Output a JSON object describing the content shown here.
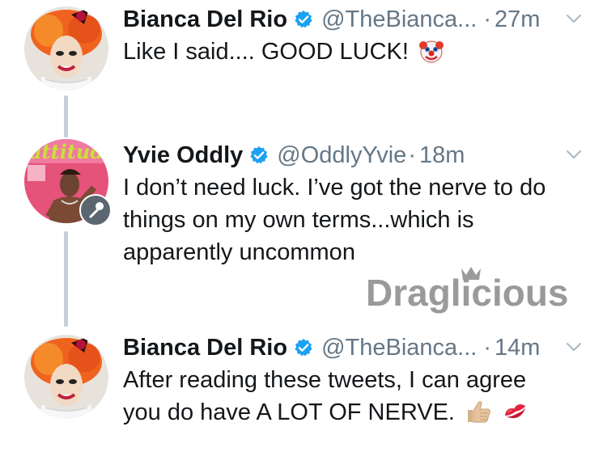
{
  "tweets": [
    {
      "name": "Bianca Del Rio",
      "handle": "@TheBianca...",
      "dot": "·",
      "time": "27m",
      "text": "Like I said.... GOOD LUCK!",
      "emojis": [
        "clown-face"
      ]
    },
    {
      "name": "Yvie Oddly",
      "handle": "@OddlyYvie",
      "dot": "·",
      "time": "18m",
      "text": "I don’t need luck. I’ve got the nerve to do things on my own terms...which is apparently uncommon",
      "emojis": []
    },
    {
      "name": "Bianca Del Rio",
      "handle": "@TheBianca...",
      "dot": "·",
      "time": "14m",
      "text": "After reading these tweets, I can agree you do have A LOT OF NERVE.",
      "emojis": [
        "thumbs-up",
        "kiss-mark"
      ]
    }
  ],
  "watermark": {
    "text": "Draglicious"
  },
  "colors": {
    "verified": "#1da1f2",
    "secondary_text": "#657786",
    "thread_line": "#c7d0d8",
    "watermark": "#9a9a9a"
  }
}
